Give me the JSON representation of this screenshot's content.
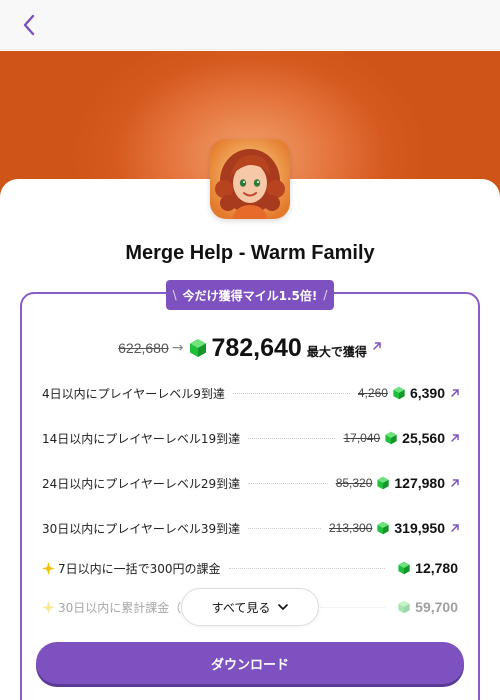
{
  "nav": {
    "back_icon": "chevron-left-icon"
  },
  "app": {
    "title": "Merge Help - Warm Family",
    "icon": "app-character-icon"
  },
  "promo": {
    "label": "今だけ獲得マイル1.5倍!"
  },
  "total": {
    "old": "622,680",
    "value": "782,640",
    "suffix": "最大で獲得"
  },
  "rows": [
    {
      "label": "4日以内にプレイヤーレベル9到達",
      "old": "4,260",
      "value": "6,390"
    },
    {
      "label": "14日以内にプレイヤーレベル19到達",
      "old": "17,040",
      "value": "25,560"
    },
    {
      "label": "24日以内にプレイヤーレベル29到達",
      "old": "85,320",
      "value": "127,980"
    },
    {
      "label": "30日以内にプレイヤーレベル39到達",
      "old": "213,300",
      "value": "319,950"
    },
    {
      "label": "7日以内に一括で300円の課金",
      "value": "12,780"
    },
    {
      "label": "30日以内に累計課金（5",
      "value": "59,700"
    }
  ],
  "see_all": {
    "label": "すべて見る"
  },
  "download": {
    "label": "ダウンロード"
  },
  "colors": {
    "accent": "#7d52c0",
    "banner": "#e4753d",
    "gem": "#1fbf3b",
    "spark": "#f2c200"
  }
}
